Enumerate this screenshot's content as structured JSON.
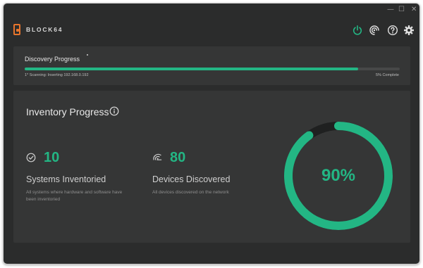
{
  "window": {
    "controls": {
      "minimize": "—",
      "maximize": "☐",
      "close": "✕"
    }
  },
  "brand": {
    "name": "BLOCK64",
    "logo_color": "#e8752c"
  },
  "toolbar": {
    "icons": [
      "power-icon",
      "signal-icon",
      "help-icon",
      "gear-icon"
    ],
    "power_icon_color": "#23b684"
  },
  "discovery": {
    "title": "Discovery Progress",
    "status_text": "1* Scanning: Inserting 192.168.0.192",
    "percent_text": "5% Complete",
    "bar_fill_fraction": 0.89
  },
  "inventory": {
    "title": "Inventory Progress",
    "systems": {
      "value": "10",
      "label": "Systems Inventoried",
      "description": "All systems where hardware and software have been inventoried"
    },
    "devices": {
      "value": "80",
      "label": "Devices Discovered",
      "description": "All devices discovered on the network"
    },
    "progress_text": "90%",
    "progress_fraction": 0.9
  },
  "colors": {
    "accent": "#23b684",
    "background": "#2b2c2c",
    "panel": "#353636",
    "track": "#474848"
  }
}
